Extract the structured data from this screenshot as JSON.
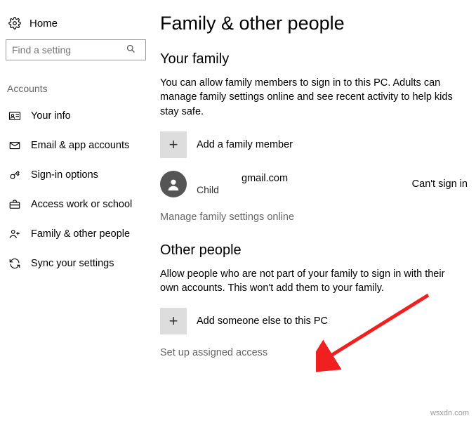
{
  "sidebar": {
    "home_label": "Home",
    "search_placeholder": "Find a setting",
    "category_label": "Accounts",
    "items": [
      {
        "label": "Your info",
        "icon": "user-card"
      },
      {
        "label": "Email & app accounts",
        "icon": "mail"
      },
      {
        "label": "Sign-in options",
        "icon": "key"
      },
      {
        "label": "Access work or school",
        "icon": "briefcase"
      },
      {
        "label": "Family & other people",
        "icon": "people-plus"
      },
      {
        "label": "Sync your settings",
        "icon": "sync"
      }
    ]
  },
  "main": {
    "title": "Family & other people",
    "family": {
      "heading": "Your family",
      "description": "You can allow family members to sign in to this PC. Adults can manage family settings online and see recent activity to help kids stay safe.",
      "add_label": "Add a family member",
      "user": {
        "email_domain": "gmail.com",
        "role": "Child",
        "status": "Can't sign in"
      },
      "manage_link": "Manage family settings online"
    },
    "other": {
      "heading": "Other people",
      "description": "Allow people who are not part of your family to sign in with their own accounts. This won't add them to your family.",
      "add_label": "Add someone else to this PC",
      "assigned_link": "Set up assigned access"
    }
  },
  "watermark": "wsxdn.com"
}
